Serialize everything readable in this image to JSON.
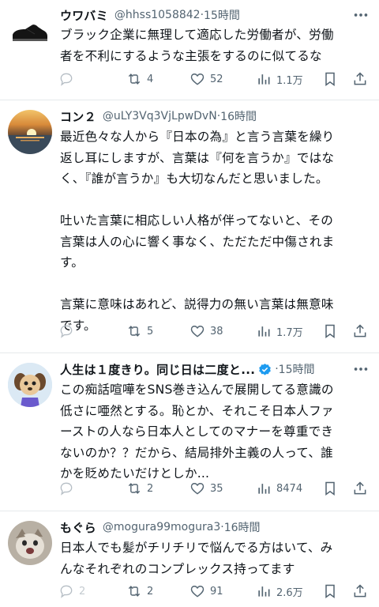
{
  "tweets": [
    {
      "name": "ウワバミ",
      "handle": "@hhss1058842",
      "sep": "·",
      "time": "15時間",
      "text": "ブラック企業に無理して適応した労働者が、労働\n者を不利にするような主張をするのに似てるな",
      "replies": "",
      "retweets": "4",
      "likes": "52",
      "views": "1.1万",
      "avatar_icon": "black-shoe-avatar"
    },
    {
      "name": "コン２",
      "handle": "@uLY3Vq3VjLpwDvN",
      "sep": "·",
      "time": "16時間",
      "text": "最近色々な人から『日本の為』と言う言葉を繰り\n返し耳にしますが、言葉は『何を言うか』ではな\nく、『誰が言うか』も大切なんだと思いました。\n\n吐いた言葉に相応しい人格が伴ってないと、その\n言葉は人の心に響く事なく、ただただ中傷されま\nす。\n\n言葉に意味はあれど、説得力の無い言葉は無意味\nです。",
      "replies": "",
      "retweets": "5",
      "likes": "38",
      "views": "1.7万",
      "avatar_icon": "sunset-sea-avatar"
    },
    {
      "name": "人生は１度きり。同じ日は二度と...",
      "handle": "",
      "sep": "·",
      "time": "15時間",
      "text": "この痴話喧嘩をSNS巻き込んで展開してる意識の\n低さに唖然とする。恥とか、それこそ日本人ファ\nーストの人なら日本人としてのマナーを尊重でき\nないのか？？だから、結局排外主義の人って、誰\nかを貶めたいだけとしか...",
      "replies": "",
      "retweets": "2",
      "likes": "35",
      "views": "8474",
      "avatar_icon": "dog-cartoon-avatar"
    },
    {
      "name": "もぐら",
      "handle": "@mogura99mogura3",
      "sep": "·",
      "time": "16時間",
      "text": "日本人でも髪がチリチリで悩んでる方はいて、み\nんなそれぞれのコンプレックス持ってます",
      "replies": "2",
      "retweets": "2",
      "likes": "91",
      "views": "2.6万",
      "avatar_icon": "cat-photo-avatar"
    }
  ],
  "colors": {
    "text": "#0f1419",
    "secondary": "#536471",
    "divider": "#e6e9eb",
    "verified": "#1d9bf0"
  }
}
